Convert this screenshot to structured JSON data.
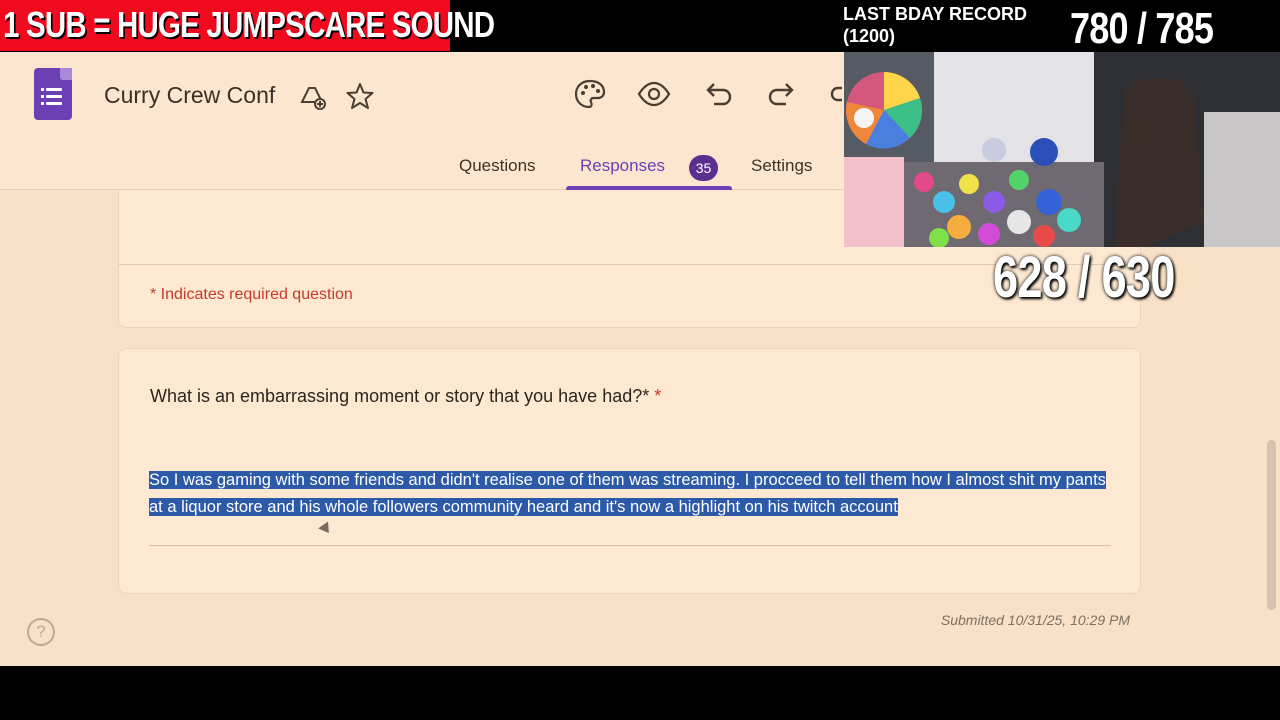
{
  "overlay": {
    "banner": "1 SUB = HUGE JUMPSCARE SOUND",
    "record_line1": "LAST BDAY RECORD",
    "record_line2": "(1200)",
    "counter_top": "780 / 785",
    "counter_mid": "628 / 630",
    "banner_color": "#f00a1e"
  },
  "form": {
    "title": "Curry Crew Conf",
    "tabs": [
      {
        "label": "Questions"
      },
      {
        "label": "Responses",
        "badge": "35"
      },
      {
        "label": "Settings"
      }
    ],
    "required_note": "* Indicates required question",
    "question": "What is an embarrassing moment or story that you have had?*",
    "required_star": "*",
    "answer": "So I was gaming with some friends and didn't realise one of them was streaming. I procceed to tell them how I almost shit my pants at a liquor store and his whole followers community heard and it's now a highlight on his twitch account",
    "submitted": "Submitted 10/31/25, 10:29 PM",
    "help_icon": "?",
    "accent_color": "#6c3fb5",
    "icons": [
      "forms-logo-icon",
      "add-to-drive-icon",
      "star-icon",
      "palette-icon",
      "eye-icon",
      "undo-icon",
      "redo-icon",
      "link-icon",
      "help-icon"
    ]
  }
}
